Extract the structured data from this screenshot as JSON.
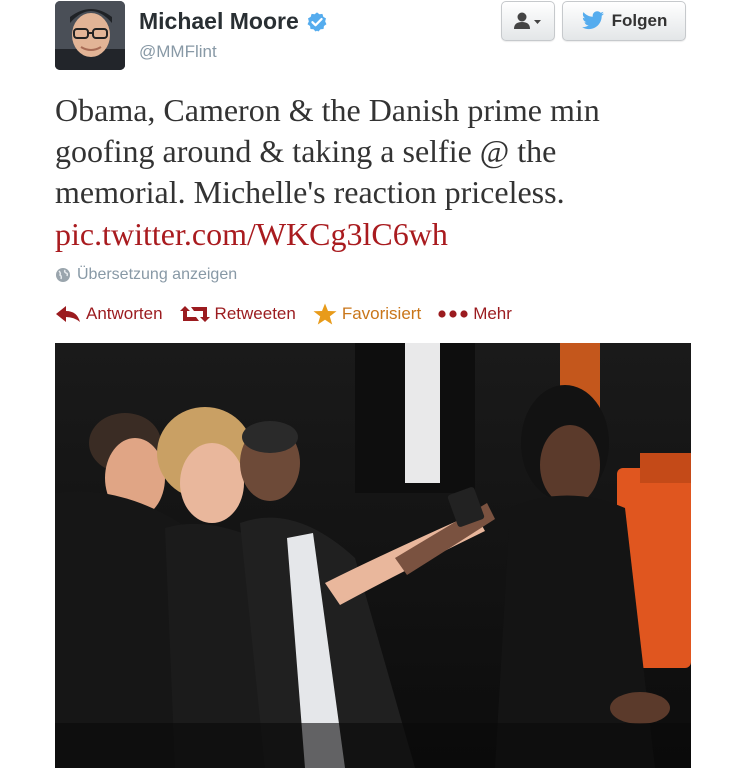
{
  "user": {
    "display_name": "Michael Moore",
    "handle": "@MMFlint",
    "verified": true
  },
  "buttons": {
    "user_menu_icon": "user-dropdown-icon",
    "follow_label": "Folgen"
  },
  "tweet": {
    "line1": "Obama, Cameron & the Danish prime min",
    "line2": "goofing around & taking a selfie @ the",
    "line3": "memorial. Michelle's reaction priceless.",
    "link": "pic.twitter.com/WKCg3lC6wh"
  },
  "translate_label": "Übersetzung anzeigen",
  "actions": {
    "reply": "Antworten",
    "retweet": "Retweeten",
    "favorite": "Favorisiert",
    "more": "Mehr"
  },
  "colors": {
    "link": "#a91b1f",
    "action": "#9b1b1f",
    "favorite": "#c9761a",
    "twitter_blue": "#55acee"
  }
}
